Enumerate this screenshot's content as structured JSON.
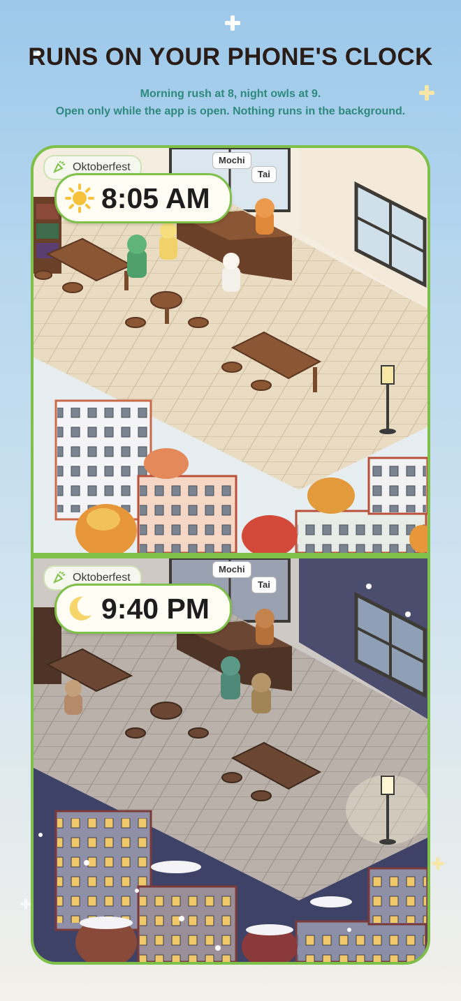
{
  "header": {
    "title": "RUNS ON YOUR PHONE'S CLOCK",
    "subtitle_line1": "Morning rush at 8, night owls at 9.",
    "subtitle_line2": "Open only while the app is open. Nothing runs in the background."
  },
  "day_scene": {
    "event_label": "Oktoberfest",
    "time": "8:05 AM",
    "time_icon": "sun-icon",
    "characters": [
      "Mochi",
      "Tai"
    ]
  },
  "night_scene": {
    "event_label": "Oktoberfest",
    "time": "9:40 PM",
    "time_icon": "moon-icon",
    "characters": [
      "Mochi",
      "Tai"
    ]
  },
  "colors": {
    "frame_green": "#7ec04a",
    "title_text": "#2a1d18",
    "subtitle_teal": "#2d8a7d"
  }
}
